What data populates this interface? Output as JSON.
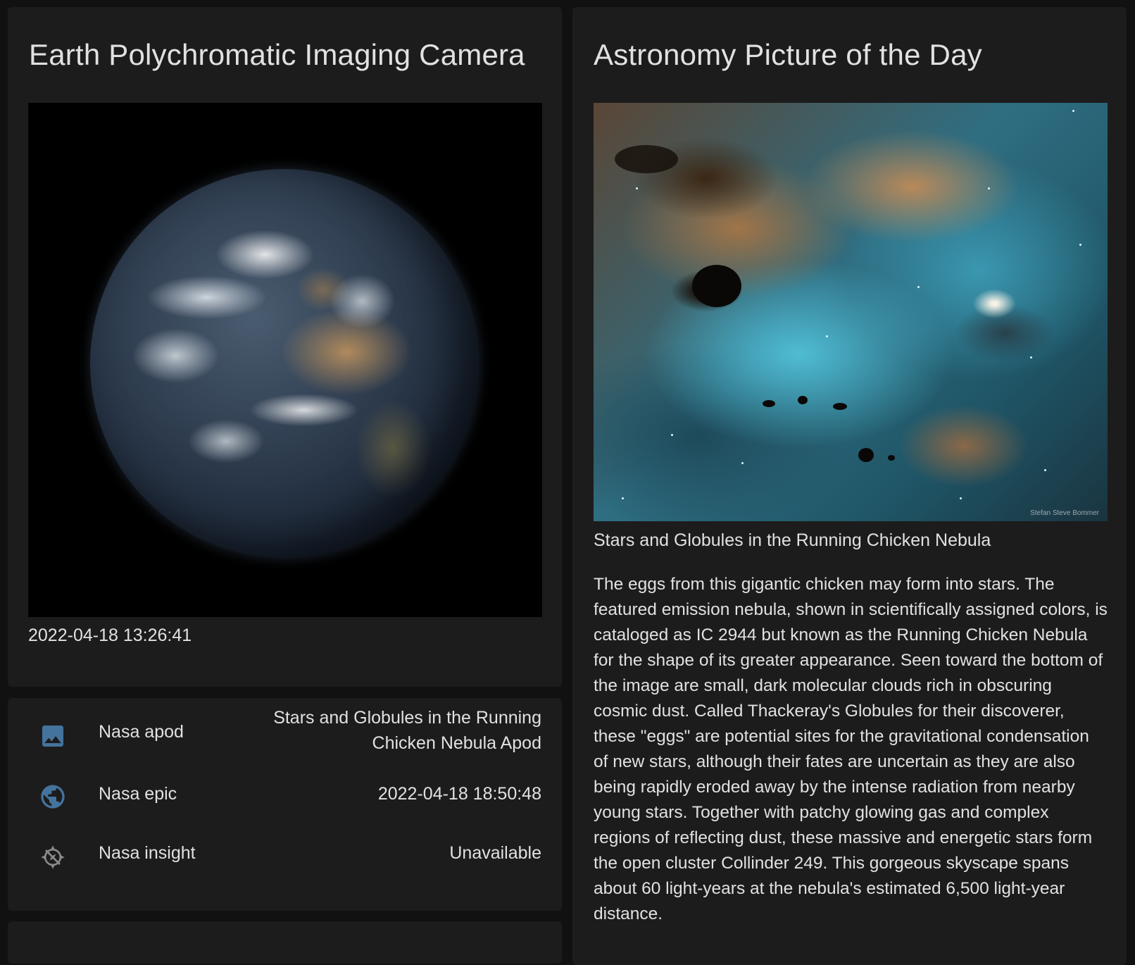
{
  "epic": {
    "title": "Earth Polychromatic Imaging Camera",
    "date": "2022-04-18 13:26:41"
  },
  "entities": [
    {
      "icon": "image-icon",
      "name": "Nasa apod",
      "state": "Stars and Globules in the Running Chicken Nebula Apod"
    },
    {
      "icon": "earth-icon",
      "name": "Nasa epic",
      "state": "2022-04-18 18:50:48"
    },
    {
      "icon": "compass-off-icon",
      "name": "Nasa insight",
      "state": "Unavailable"
    }
  ],
  "apod": {
    "title": "Astronomy Picture of the Day",
    "image_title": "Stars and Globules in the Running Chicken Nebula",
    "credit": "Stefan Steve Bommer",
    "explanation": "The eggs from this gigantic chicken may form into stars. The featured emission nebula, shown in scientifically assigned colors, is cataloged as IC 2944 but known as the Running Chicken Nebula for the shape of its greater appearance. Seen toward the bottom of the image are small, dark molecular clouds rich in obscuring cosmic dust. Called Thackeray's Globules for their discoverer, these \"eggs\" are potential sites for the gravitational condensation of new stars, although their fates are uncertain as they are also being rapidly eroded away by the intense radiation from nearby young stars. Together with patchy glowing gas and complex regions of reflecting dust, these massive and energetic stars form the open cluster Collinder 249. This gorgeous skyscape spans about 60 light-years at the nebula's estimated 6,500 light-year distance."
  },
  "colors": {
    "background": "#111111",
    "card": "#1c1c1c",
    "text": "#e1e1e1",
    "icon": "#44739e"
  }
}
